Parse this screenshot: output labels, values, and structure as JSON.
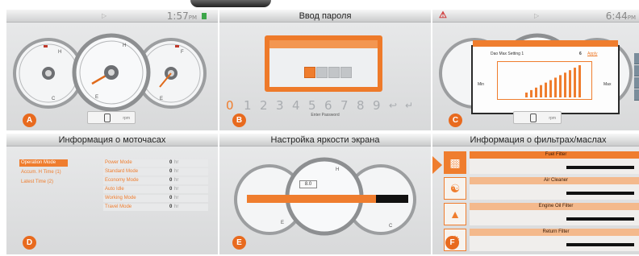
{
  "panels": {
    "a": {
      "letter": "A",
      "clock": "1:57",
      "ampm": "PM",
      "unit_text": "rpm",
      "colors": {
        "accent": "#e86a1e",
        "status_green": "#3da64a"
      },
      "icons": [
        "temperature-gauge-icon",
        "speedometer-icon",
        "fuel-gauge-icon",
        "warning-lamp-icon",
        "eco-mode-icon"
      ]
    },
    "b": {
      "letter": "B",
      "title": "Ввод пароля",
      "keypad": [
        "0",
        "1",
        "2",
        "3",
        "4",
        "5",
        "6",
        "7",
        "8",
        "9",
        "↩",
        "↵"
      ],
      "selected_key": "0",
      "hint": "Enter Password",
      "entered_digits": 1,
      "total_digits": 4
    },
    "c": {
      "letter": "C",
      "clock": "6:44",
      "ampm": "PM",
      "warning_icon": "engine-warning-icon",
      "unit_text": "rpm",
      "chart_title": "Dao Max Setting 1",
      "chart_value": "6",
      "chart_unit": "Apply",
      "min_label": "Min",
      "max_label": "Max",
      "levels": 12,
      "current_level": 12
    },
    "d": {
      "letter": "D",
      "title": "Информация о моточасах",
      "left_items": [
        "Operation Mode",
        "Accum. H Time (1)",
        "Latest Time (2)"
      ],
      "selected_left": "Operation Mode",
      "right_items": [
        {
          "label": "Power Mode",
          "value": "0",
          "unit": "hr"
        },
        {
          "label": "Standard Mode",
          "value": "0",
          "unit": "hr"
        },
        {
          "label": "Economy Mode",
          "value": "0",
          "unit": "hr"
        },
        {
          "label": "Auto Idle",
          "value": "0",
          "unit": "hr"
        },
        {
          "label": "Working Mode",
          "value": "0",
          "unit": "hr"
        },
        {
          "label": "Travel Mode",
          "value": "0",
          "unit": "hr"
        }
      ]
    },
    "e": {
      "letter": "E",
      "title": "Настройка яркости экрана",
      "brightness_label": "8.0",
      "brightness_fraction": 0.8
    },
    "f": {
      "letter": "F",
      "title": "Информация о фильтрах/маслах",
      "items": [
        {
          "name": "Fuel Filter",
          "icon": "fuel-filter-icon",
          "selected": true,
          "fill": 1.0
        },
        {
          "name": "Air Cleaner",
          "icon": "air-cleaner-icon",
          "selected": false,
          "fill": 0.95
        },
        {
          "name": "Engine Oil Filter",
          "icon": "oil-filter-icon",
          "selected": false,
          "fill": 0.95
        },
        {
          "name": "Return Filter",
          "icon": "return-filter-icon",
          "selected": false,
          "fill": 0.95
        }
      ]
    }
  }
}
